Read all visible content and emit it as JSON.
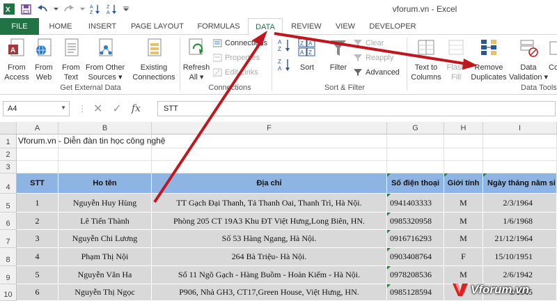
{
  "window": {
    "title": "vforum.vn - Excel"
  },
  "tabs": [
    "FILE",
    "HOME",
    "INSERT",
    "PAGE LAYOUT",
    "FORMULAS",
    "DATA",
    "REVIEW",
    "VIEW",
    "DEVELOPER"
  ],
  "ribbon": {
    "get_external": {
      "from_access": [
        "From",
        "Access"
      ],
      "from_web": [
        "From",
        "Web"
      ],
      "from_text": [
        "From",
        "Text"
      ],
      "from_other": [
        "From Other",
        "Sources ▾"
      ],
      "existing": [
        "Existing",
        "Connections"
      ],
      "label": "Get External Data"
    },
    "connections": {
      "refresh": [
        "Refresh",
        "All ▾"
      ],
      "connections": "Connections",
      "properties": "Properties",
      "edit_links": "Edit Links",
      "label": "Connections"
    },
    "sort_filter": {
      "sort": "Sort",
      "filter": "Filter",
      "clear": "Clear",
      "reapply": "Reapply",
      "advanced": "Advanced",
      "label": "Sort & Filter"
    },
    "data_tools": {
      "text_to_columns": [
        "Text to",
        "Columns"
      ],
      "flash_fill": [
        "Flash",
        "Fill"
      ],
      "remove_duplicates": [
        "Remove",
        "Duplicates"
      ],
      "data_validation": [
        "Data",
        "Validation ▾"
      ],
      "co": [
        "Co",
        ""
      ],
      "label": "Data Tools"
    }
  },
  "formula_bar": {
    "name_box": "A4",
    "fx": "fx",
    "content": "STT"
  },
  "grid": {
    "columns": [
      "A",
      "B",
      "F",
      "G",
      "H",
      "I"
    ],
    "row_numbers": [
      "1",
      "2",
      "3",
      "4",
      "5",
      "6",
      "7",
      "8",
      "9",
      "10"
    ],
    "a1": "Vforum.vn - Diễn đàn tin học công nghệ",
    "headers": [
      "STT",
      "Ho tên",
      "Địa chỉ",
      "Số điện thoại",
      "Giới tính",
      "Ngày tháng năm si"
    ],
    "rows": [
      [
        "1",
        "Nguyễn Huy Hùng",
        "TT Gạch Đại Thanh, Tả Thanh Oai, Thanh Trì, Hà Nội.",
        "0941403333",
        "M",
        "2/3/1964"
      ],
      [
        "2",
        "Lê Tiến Thành",
        "Phòng 205 CT 19A3 Khu ĐT  Việt Hưng,Long Biên, HN.",
        "0985320958",
        "M",
        "1/6/1968"
      ],
      [
        "3",
        "Nguyễn Chi Lương",
        "Số 53 Hàng Ngang, Hà Nội.",
        "0916716293",
        "M",
        "21/12/1964"
      ],
      [
        "4",
        "Phạm Thị Nội",
        "264 Bà Triệu- Hà Nội.",
        "0903408764",
        "F",
        "15/10/1951"
      ],
      [
        "5",
        "Nguyễn Văn Ha",
        "Số 11 Ngõ Gạch - Hàng Buồm - Hoàn Kiếm - Hà Nội.",
        "0978208536",
        "M",
        "2/6/1942"
      ],
      [
        "6",
        "Nguyễn Thị Ngọc",
        "P906, Nhà GH3, CT17,Green House, Việt Hưng, HN.",
        "0985128594",
        "F",
        "6/1945"
      ]
    ]
  },
  "watermark": "Vforum.vn",
  "colors": {
    "excel_green": "#217346",
    "header_blue": "#8db4e2",
    "table_gray": "#d9d9d9",
    "arrow_red": "#c0161e"
  }
}
